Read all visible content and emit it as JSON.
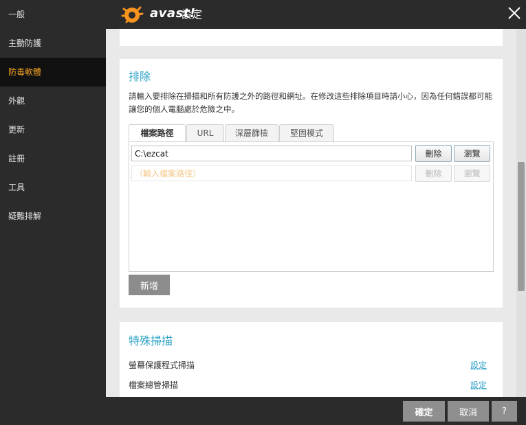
{
  "window": {
    "brand": "avast!",
    "title": "設定"
  },
  "sidebar": {
    "items": [
      {
        "label": "一般"
      },
      {
        "label": "主動防護"
      },
      {
        "label": "防毒軟體"
      },
      {
        "label": "外觀"
      },
      {
        "label": "更新"
      },
      {
        "label": "註冊"
      },
      {
        "label": "工具"
      },
      {
        "label": "疑難排解"
      }
    ],
    "active_index": 2
  },
  "exclusions": {
    "title": "排除",
    "description": "請輸入要排除在掃描和所有防護之外的路徑和網址。在修改這些排除項目時請小心，因為任何錯誤都可能讓您的個人電腦處於危險之中。",
    "tabs": [
      {
        "label": "檔案路徑"
      },
      {
        "label": "URL"
      },
      {
        "label": "深層篩檢"
      },
      {
        "label": "堅固模式"
      }
    ],
    "active_tab": 0,
    "rows": [
      {
        "value": "C:\\ezcat",
        "remove_label": "刪除",
        "browse_label": "瀏覽"
      },
      {
        "placeholder": "（輸入檔案路徑）",
        "remove_label": "刪除",
        "browse_label": "瀏覽"
      }
    ],
    "add_label": "新增"
  },
  "special_scans": {
    "title": "特殊掃描",
    "items": [
      {
        "label": "螢幕保護程式掃描",
        "link": "設定"
      },
      {
        "label": "檔案總管掃描",
        "link": "設定"
      }
    ]
  },
  "footer": {
    "ok_label": "確定",
    "cancel_label": "取消",
    "help_label": "?"
  },
  "colors": {
    "accent": "#2fa3c7",
    "active_sidebar_text": "#f7a224",
    "logo_orange": "#f7931e"
  }
}
